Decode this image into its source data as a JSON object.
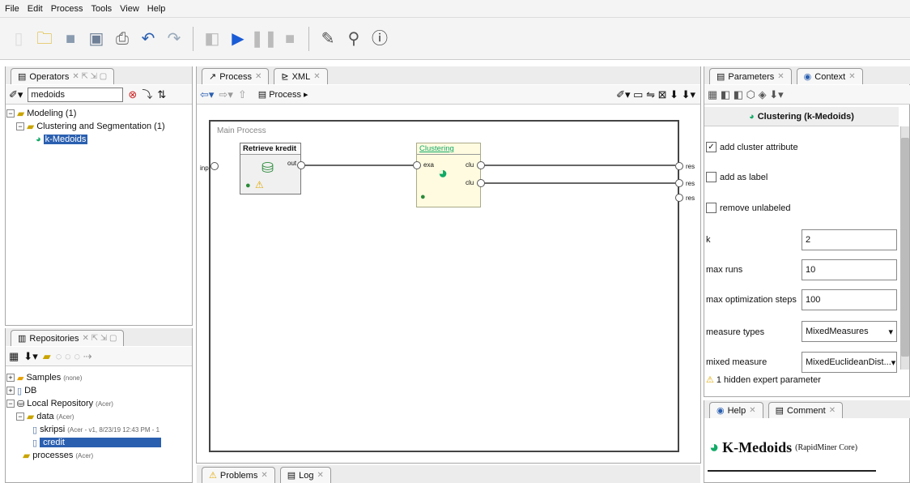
{
  "menu": [
    "File",
    "Edit",
    "Process",
    "Tools",
    "View",
    "Help"
  ],
  "operators": {
    "tab": "Operators",
    "search_value": "medoids",
    "tree": {
      "modeling": "Modeling (1)",
      "clustering": "Clustering and Segmentation (1)",
      "kmedoids": "k-Medoids"
    }
  },
  "repositories": {
    "tab": "Repositories",
    "items": {
      "samples": "Samples",
      "samples_note": "(none)",
      "db": "DB",
      "local": "Local Repository",
      "local_note": "(Acer)",
      "data": "data",
      "data_note": "(Acer)",
      "skripsi": "skripsi",
      "skripsi_note": "(Acer - v1, 8/23/19 12:43 PM - 1",
      "credit": "credit",
      "processes": "processes",
      "processes_note": "(Acer)"
    }
  },
  "process": {
    "tabs": [
      "Process",
      "XML"
    ],
    "breadcrumb": "Process",
    "main_label": "Main Process",
    "ops": {
      "retrieve": "Retrieve kredit",
      "clustering": "Clustering"
    },
    "ports": {
      "inp": "inp",
      "out": "out",
      "exa": "exa",
      "clu1": "clu",
      "clu2": "clu",
      "res1": "res",
      "res2": "res",
      "res3": "res"
    }
  },
  "bottom_tabs": [
    "Problems",
    "Log"
  ],
  "params": {
    "tabs": [
      "Parameters",
      "Context"
    ],
    "title": "Clustering (k-Medoids)",
    "add_cluster_attribute": "add cluster attribute",
    "add_as_label": "add as label",
    "remove_unlabeled": "remove unlabeled",
    "k_label": "k",
    "k_value": "2",
    "max_runs_label": "max runs",
    "max_runs_value": "10",
    "max_opt_label": "max optimization steps",
    "max_opt_value": "100",
    "measure_types_label": "measure types",
    "measure_types_value": "MixedMeasures",
    "mixed_measure_label": "mixed measure",
    "mixed_measure_value": "MixedEuclideanDist...",
    "hidden": "1 hidden expert parameter"
  },
  "help": {
    "tabs": [
      "Help",
      "Comment"
    ],
    "title": "K-Medoids",
    "subtitle": "(RapidMiner Core)"
  }
}
